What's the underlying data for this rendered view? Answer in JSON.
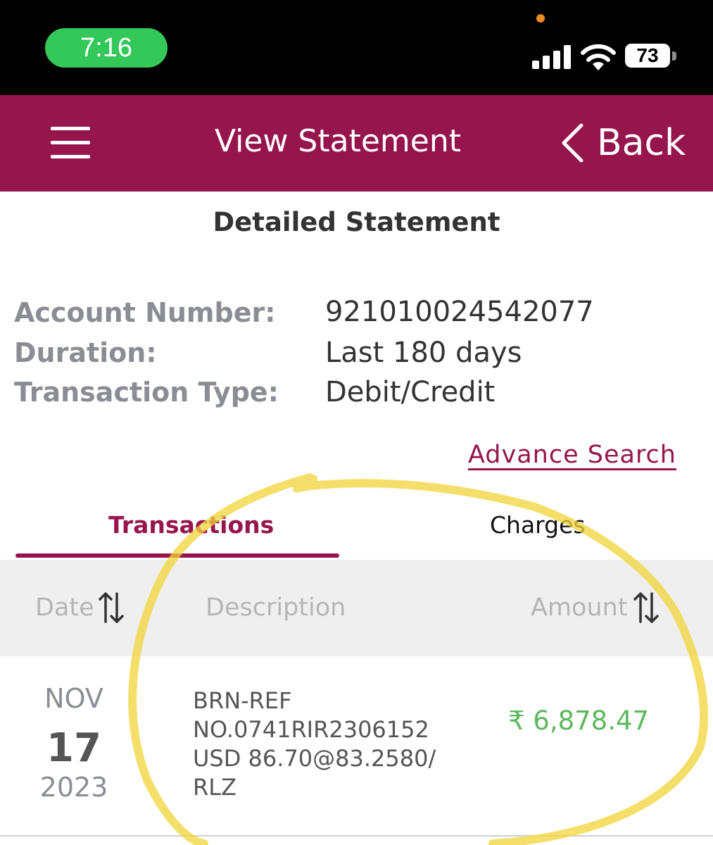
{
  "status_bar": {
    "time": "7:16",
    "battery": "73"
  },
  "header": {
    "title": "View Statement",
    "back_label": "Back"
  },
  "statement": {
    "title": "Detailed Statement",
    "account_label": "Account Number:",
    "account_value": "921010024542077",
    "duration_label": "Duration:",
    "duration_value": "Last 180 days",
    "type_label": "Transaction Type:",
    "type_value": "Debit/Credit"
  },
  "advance_search": "Advance Search",
  "tabs": [
    {
      "label": "Transactions",
      "active": true
    },
    {
      "label": "Charges",
      "active": false
    }
  ],
  "table": {
    "headers": {
      "date": "Date",
      "description": "Description",
      "amount": "Amount"
    },
    "rows": [
      {
        "month": "NOV",
        "day": "17",
        "year": "2023",
        "description_lines": [
          "BRN-REF",
          "NO.0741RIR2306152",
          "USD 86.70@83.2580/",
          "RLZ"
        ],
        "amount": "₹ 6,878.47"
      }
    ]
  },
  "colors": {
    "brand": "#96154d",
    "credit_amount": "#5cb85c",
    "annotation_highlight": "#f2d43a"
  }
}
